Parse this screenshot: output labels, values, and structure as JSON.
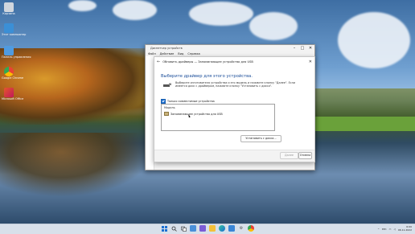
{
  "desktop": {
    "icons": [
      {
        "name": "recycle-bin",
        "label": "Корзина",
        "color": "#d0d6de"
      },
      {
        "name": "this-pc",
        "label": "Этот компьютер",
        "color": "#3b8fd6"
      },
      {
        "name": "control-panel",
        "label": "Панель управления",
        "color": "#4f9be0"
      },
      {
        "name": "chrome",
        "label": "Google Chrome",
        "color": "#e94235"
      },
      {
        "name": "office",
        "label": "Microsoft Office",
        "color": "#e3572b"
      }
    ]
  },
  "window": {
    "title": "Диспетчер устройств",
    "menu": [
      "Файл",
      "Действие",
      "Вид",
      "Справка"
    ]
  },
  "dialog": {
    "title": "Обновить драйверы — Запоминающее устройство для USB",
    "heading": "Выберите драйвер для этого устройства.",
    "description": "Выберите изготовителя устройства и его модель и нажмите кнопку \"Далее\". Если имеется диск с драйвером, нажмите кнопку \"Установить с диска\".",
    "checkbox_label": "Только совместимые устройства",
    "checkbox_checked": true,
    "list_header": "Модель",
    "list_items": [
      "Запоминающее устройство для USB"
    ],
    "have_disk_label": "Установить с диска...",
    "next_label": "Далее",
    "cancel_label": "Отмена"
  },
  "taskbar": {
    "apps": [
      "start",
      "search",
      "task-view",
      "widgets",
      "chat",
      "explorer",
      "edge",
      "store",
      "settings",
      "chrome"
    ],
    "tray": {
      "lang": "РУС",
      "time": "6:00",
      "date": "06.11.2022"
    }
  },
  "colors": {
    "accent": "#1a6fd1",
    "heading": "#1a4d99"
  }
}
